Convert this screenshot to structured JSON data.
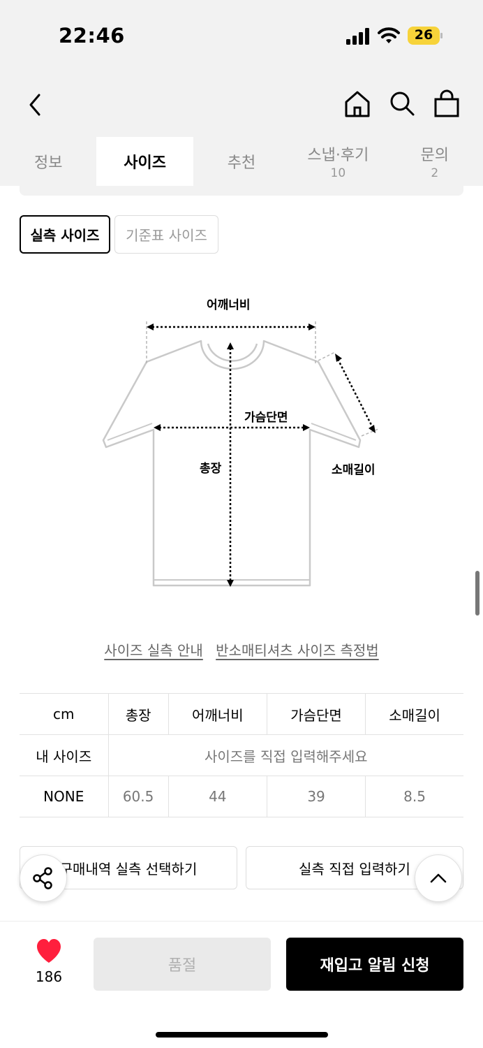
{
  "status_bar": {
    "time": "22:46",
    "battery": "26"
  },
  "tabs": [
    {
      "label": "정보",
      "count": ""
    },
    {
      "label": "사이즈",
      "count": ""
    },
    {
      "label": "추천",
      "count": ""
    },
    {
      "label": "스냅·후기",
      "count": "10"
    },
    {
      "label": "문의",
      "count": "2"
    }
  ],
  "size_tabs": {
    "actual": "실측 사이즈",
    "standard": "기준표 사이즈"
  },
  "diagram": {
    "shoulder": "어깨너비",
    "chest": "가슴단면",
    "length": "총장",
    "sleeve": "소매길이"
  },
  "guides": {
    "measure_guide": "사이즈 실측 안내",
    "method": "반소매티셔츠 사이즈 측정법"
  },
  "table": {
    "headers": [
      "cm",
      "총장",
      "어깨너비",
      "가슴단면",
      "소매길이"
    ],
    "my_size_label": "내 사이즈",
    "my_size_message": "사이즈를 직접 입력해주세요",
    "rows": [
      {
        "label": "NONE",
        "values": [
          "60.5",
          "44",
          "39",
          "8.5"
        ]
      }
    ]
  },
  "actions": {
    "select_purchase": "구매내역 실측 선택하기",
    "direct_input": "실측 직접 입력하기"
  },
  "bottom": {
    "likes": "186",
    "sold_out": "품절",
    "restock": "재입고 알림 신청"
  },
  "colors": {
    "heart": "#ff1f3d",
    "battery": "#f7d33a",
    "primary_button": "#000000"
  }
}
